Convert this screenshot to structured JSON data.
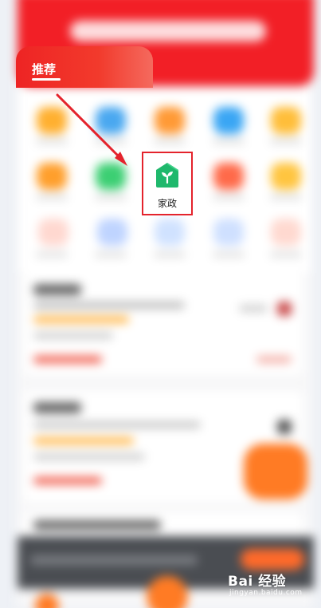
{
  "tab": {
    "label": "推荐"
  },
  "highlighted_app": {
    "label": "家政",
    "icon": "house-sprout-icon",
    "accent": "#1fb86c"
  },
  "highlight_border_color": "#e4232c",
  "annotation_arrow": {
    "icon": "arrow-icon",
    "color": "#e4232c"
  },
  "watermark": {
    "brand": "Bai 经验",
    "url": "jingyan.baidu.com"
  }
}
